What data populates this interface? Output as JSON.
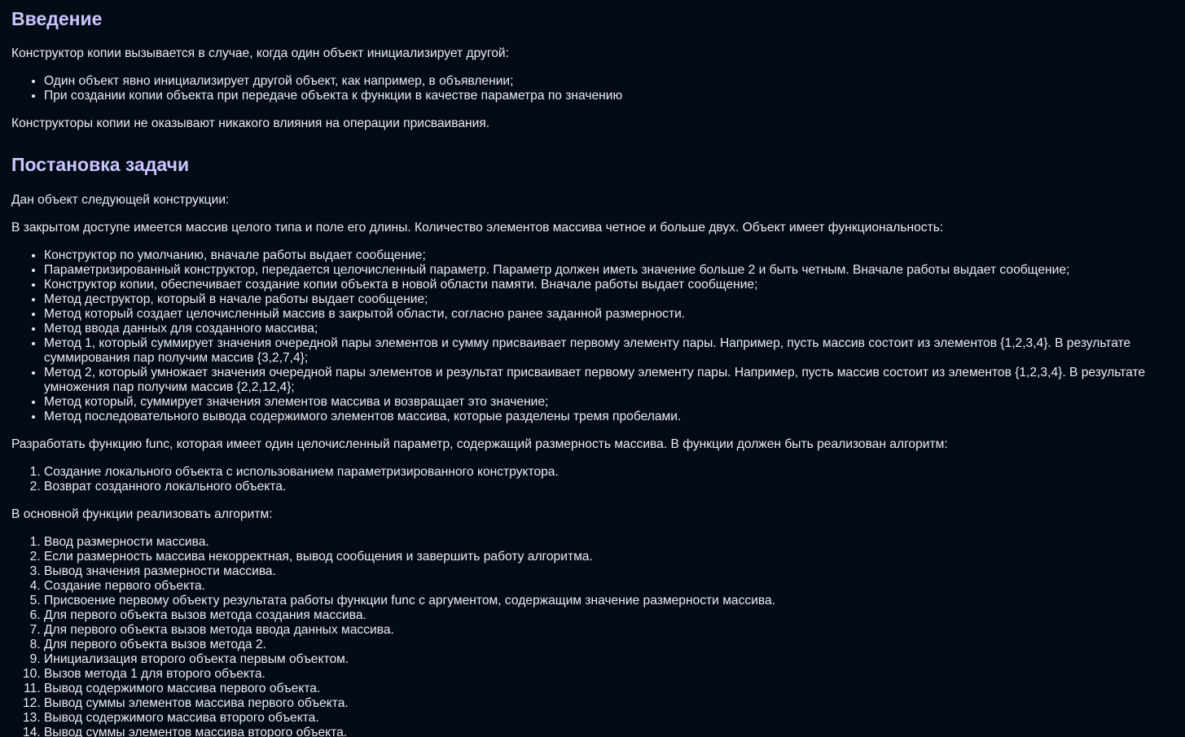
{
  "intro": {
    "heading": "Введение",
    "paragraph1": "Конструктор копии вызывается в случае, когда один объект инициализирует другой:",
    "bullets": [
      "Один объект явно инициализирует другой объект, как например, в объявлении;",
      "При создании копии объекта при передаче объекта к функции в качестве параметра по значению"
    ],
    "paragraph2": "Конструкторы копии не оказывают никакого влияния на операции присваивания."
  },
  "task": {
    "heading": "Постановка задачи",
    "paragraph1": "Дан объект следующей конструкции:",
    "paragraph2": "В закрытом доступе имеется массив целого типа и поле его длины. Количество элементов массива четное и больше двух. Объект имеет функциональность:",
    "features": [
      "Конструктор по умолчанию, вначале работы выдает сообщение;",
      "Параметризированный конструктор, передается целочисленный параметр. Параметр должен иметь значение больше 2 и быть четным. Вначале работы выдает сообщение;",
      "Конструктор копии, обеспечивает создание копии объекта в новой области памяти. Вначале работы выдает сообщение;",
      "Метод деструктор, который в начале работы выдает сообщение;",
      "Метод который создает целочисленный массив в закрытой области, согласно ранее заданной размерности.",
      "Метод ввода данных для созданного массива;",
      "Метод 1, который суммирует значения очередной пары элементов и сумму присваивает первому элементу пары. Например, пусть массив состоит из элементов {1,2,3,4}. В результате суммирования пар получим массив {3,2,7,4};",
      "Метод 2, который умножает значения очередной пары элементов и результат присваивает первому элементу пары. Например, пусть массив состоит из элементов {1,2,3,4}. В результате умножения пар получим массив {2,2,12,4};",
      "Метод который, суммирует значения элементов массива и возвращает это значение;",
      "Метод последовательного вывода содержимого элементов массива, которые разделены тремя пробелами."
    ],
    "paragraph3": "Разработать функцию func, которая имеет один целочисленный параметр, содержащий размерность массива. В функции должен быть реализован алгоритм:",
    "func_steps": [
      "Создание локального объекта с использованием параметризированного конструктора.",
      "Возврат созданного локального объекта."
    ],
    "paragraph4": "В основной функции реализовать алгоритм:",
    "main_steps": [
      "Ввод размерности массива.",
      "Если размерность массива некорректная, вывод сообщения и завершить работу алгоритма.",
      "Вывод значения размерности массива.",
      "Создание первого объекта.",
      "Присвоение первому объекту результата работы функции func с аргументом, содержащим значение размерности массива.",
      "Для первого объекта вызов метода создания массива.",
      "Для первого объекта вызов метода ввода данных массива.",
      "Для первого объекта вызов метода 2.",
      "Инициализация второго объекта первым объектом.",
      "Вызов метода 1 для второго объекта.",
      "Вывод содержимого массива первого объекта.",
      "Вывод суммы элементов массива первого объекта.",
      "Вывод содержимого массива второго объекта.",
      "Вывод суммы элементов массива второго объекта."
    ]
  },
  "colors": {
    "background": "#050b16",
    "heading": "#c9c6ff",
    "text": "#e9ecf2"
  }
}
